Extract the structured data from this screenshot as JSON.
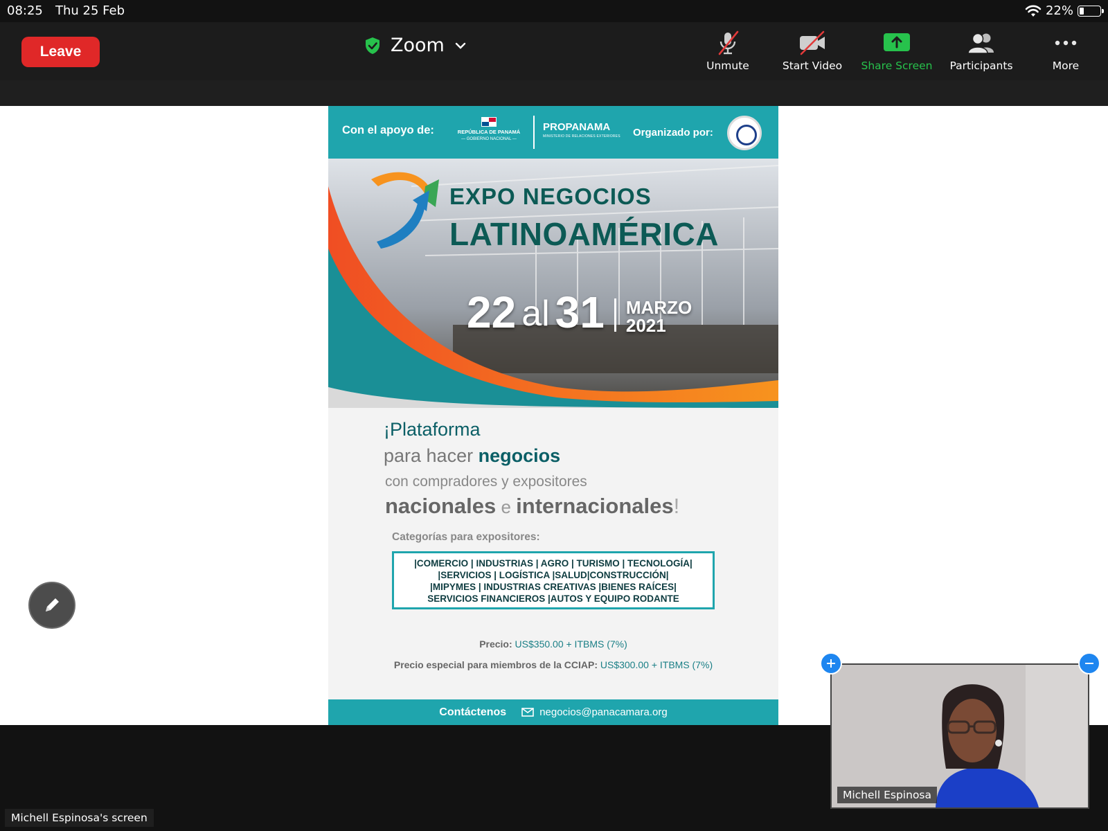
{
  "status_bar": {
    "time": "08:25",
    "date": "Thu 25 Feb",
    "battery": "22%",
    "battery_level": 0.22
  },
  "toolbar": {
    "leave_label": "Leave",
    "meeting_title": "Zoom",
    "tools": [
      {
        "label": "Unmute",
        "icon": "mic-muted-icon"
      },
      {
        "label": "Start Video",
        "icon": "video-off-icon"
      },
      {
        "label": "Share Screen",
        "icon": "share-screen-icon"
      },
      {
        "label": "Participants",
        "icon": "participants-icon"
      },
      {
        "label": "More",
        "icon": "more-icon"
      }
    ]
  },
  "poster": {
    "support_label": "Con el apoyo de:",
    "gov_name": "REPÚBLICA DE PANAMÁ",
    "gov_sub": "— GOBIERNO NACIONAL —",
    "propanama": "PROPANAMA",
    "propanama_sub": "MINISTERIO DE RELACIONES EXTERIORES",
    "organized_label": "Organizado por:",
    "title_line1": "EXPO NEGOCIOS",
    "title_line2": "LATINOAMÉRICA",
    "date_start": "22",
    "date_al": "al",
    "date_end": "31",
    "date_month": "MARZO",
    "date_year": "2021",
    "tag_line1": "¡Plataforma",
    "tag_line2_pre": "para hacer ",
    "tag_line2_bold": "negocios",
    "tag_line3": "con compradores y expositores",
    "tag_line4_a": "nacionales",
    "tag_line4_e": " e ",
    "tag_line4_b": "internacionales",
    "tag_line4_x": "!",
    "categories_title": "Categorías para expositores:",
    "categories_lines": [
      "|COMERCIO | INDUSTRIAS | AGRO | TURISMO | TECNOLOGÍA|",
      "|SERVICIOS | LOGÍSTICA |SALUD|CONSTRUCCIÓN|",
      "|MIPYMES  | INDUSTRIAS CREATIVAS |BIENES RAÍCES|",
      "SERVICIOS FINANCIEROS |AUTOS Y EQUIPO RODANTE"
    ],
    "price_label": "Precio:",
    "price_value": "US$350.00 + ITBMS (7%)",
    "special_label": "Precio especial para miembros de la CCIAP:",
    "special_value": "US$300.00 + ITBMS (7%)",
    "contact_label": "Contáctenos",
    "contact_email": "negocios@panacamara.org"
  },
  "video": {
    "participant_name": "Michell Espinosa"
  },
  "screen_label": "Michell Espinosa's screen",
  "colors": {
    "leave": "#e02828",
    "share_green": "#27c24c",
    "poster_teal": "#1fa5ad",
    "poster_orange": "#f26a21",
    "title_green": "#0c5a55",
    "control_blue": "#1e86f0"
  }
}
